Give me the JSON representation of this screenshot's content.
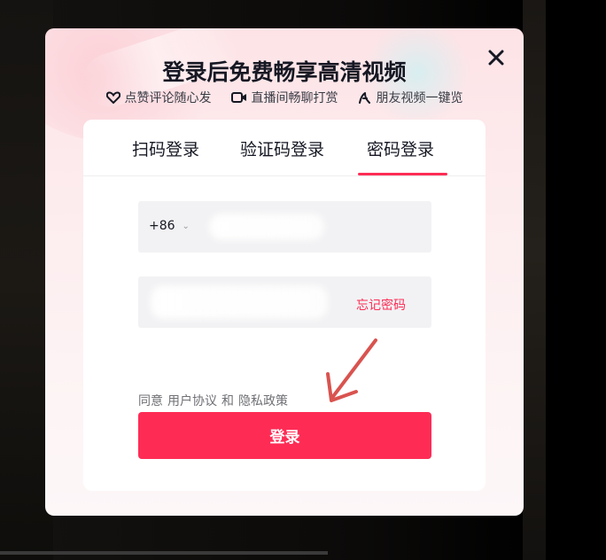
{
  "modal": {
    "title": "登录后免费畅享高清视频",
    "close_icon": "close-icon",
    "features": [
      {
        "icon": "heart-icon",
        "label": "点赞评论随心发"
      },
      {
        "icon": "video-camera-icon",
        "label": "直播间畅聊打赏"
      },
      {
        "icon": "friends-icon",
        "label": "朋友视频一键览"
      }
    ]
  },
  "tabs": [
    {
      "label": "扫码登录",
      "active": false
    },
    {
      "label": "验证码登录",
      "active": false
    },
    {
      "label": "密码登录",
      "active": true
    }
  ],
  "form": {
    "country_code": "+86",
    "phone_value": "",
    "password_value": "",
    "forgot_password": "忘记密码",
    "agreement": {
      "prefix": "同意",
      "user_agreement": "用户协议",
      "conjunction": "和",
      "privacy_policy": "隐私政策"
    },
    "login_button": "登录"
  },
  "colors": {
    "accent": "#fe2c55",
    "arrow_annotation": "#d9534f"
  }
}
